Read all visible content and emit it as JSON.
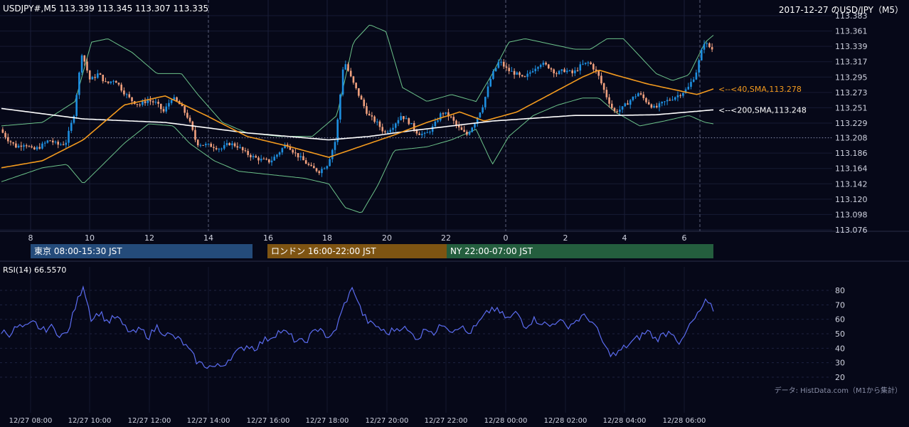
{
  "header": {
    "ohlc": "USDJPY#,M5 113.339 113.345 113.307 113.335",
    "title_right": "2017-12-27 のUSD/JPY（M5）"
  },
  "sessions": {
    "tokyo": "東京 08:00-15:30 JST",
    "london": "ロンドン 16:00-22:00 JST",
    "ny": "NY 22:00-07:00 JST"
  },
  "rsi": {
    "label": "RSI(14) 66.5570"
  },
  "credit": "データ: HistData.com（M1から集計）",
  "colors": {
    "bull": "#1e8fe0",
    "bear": "#f0a07e",
    "sma40": "#f39a1e",
    "sma200": "#ffffff",
    "bands": "#6cc28a",
    "rsi": "#5b6cf0"
  },
  "chart_data": [
    {
      "type": "candlestick",
      "ylim": [
        113.076,
        113.383
      ],
      "y_ticks": [
        "113.383",
        "113.361",
        "113.339",
        "113.317",
        "113.295",
        "113.273",
        "113.251",
        "113.229",
        "113.208",
        "113.186",
        "113.164",
        "113.142",
        "113.120",
        "113.098",
        "113.076"
      ],
      "x_ticks": [
        "8",
        "10",
        "12",
        "14",
        "16",
        "18",
        "20",
        "22",
        "0",
        "2",
        "4",
        "6"
      ],
      "annotations": [
        {
          "text": "<--<40,SMA,113.278",
          "value": 113.278
        },
        {
          "text": "<--<200,SMA,113.248",
          "value": 113.248
        }
      ],
      "reference_line": 113.208,
      "price_path": [
        [
          0,
          113.22
        ],
        [
          1,
          113.205
        ],
        [
          2,
          113.195
        ],
        [
          3,
          113.2
        ],
        [
          4,
          113.19
        ],
        [
          5,
          113.196
        ],
        [
          6,
          113.205
        ],
        [
          7,
          113.198
        ],
        [
          8,
          113.2
        ],
        [
          9,
          113.24
        ],
        [
          10,
          113.33
        ],
        [
          11,
          113.29
        ],
        [
          12,
          113.3
        ],
        [
          13,
          113.285
        ],
        [
          14,
          113.292
        ],
        [
          15,
          113.275
        ],
        [
          16,
          113.262
        ],
        [
          17,
          113.255
        ],
        [
          18,
          113.262
        ],
        [
          19,
          113.258
        ],
        [
          20,
          113.245
        ],
        [
          21,
          113.266
        ],
        [
          22,
          113.255
        ],
        [
          23,
          113.236
        ],
        [
          24,
          113.2
        ],
        [
          25,
          113.198
        ],
        [
          26,
          113.196
        ],
        [
          27,
          113.192
        ],
        [
          28,
          113.2
        ],
        [
          29,
          113.196
        ],
        [
          30,
          113.186
        ],
        [
          31,
          113.18
        ],
        [
          32,
          113.176
        ],
        [
          33,
          113.174
        ],
        [
          34,
          113.186
        ],
        [
          35,
          113.2
        ],
        [
          36,
          113.186
        ],
        [
          37,
          113.176
        ],
        [
          38,
          113.165
        ],
        [
          39,
          113.16
        ],
        [
          40,
          113.17
        ],
        [
          41,
          113.205
        ],
        [
          42,
          113.32
        ],
        [
          43,
          113.29
        ],
        [
          44,
          113.265
        ],
        [
          45,
          113.24
        ],
        [
          46,
          113.23
        ],
        [
          47,
          113.215
        ],
        [
          48,
          113.225
        ],
        [
          49,
          113.24
        ],
        [
          50,
          113.23
        ],
        [
          51,
          113.215
        ],
        [
          52,
          113.212
        ],
        [
          53,
          113.225
        ],
        [
          54,
          113.245
        ],
        [
          55,
          113.238
        ],
        [
          56,
          113.222
        ],
        [
          57,
          113.212
        ],
        [
          58,
          113.23
        ],
        [
          59,
          113.255
        ],
        [
          60,
          113.295
        ],
        [
          61,
          113.318
        ],
        [
          62,
          113.305
        ],
        [
          63,
          113.3
        ],
        [
          64,
          113.292
        ],
        [
          65,
          113.305
        ],
        [
          66,
          113.315
        ],
        [
          67,
          113.31
        ],
        [
          68,
          113.3
        ],
        [
          69,
          113.305
        ],
        [
          70,
          113.3
        ],
        [
          71,
          113.312
        ],
        [
          72,
          113.316
        ],
        [
          73,
          113.3
        ],
        [
          74,
          113.27
        ],
        [
          75,
          113.245
        ],
        [
          76,
          113.25
        ],
        [
          77,
          113.262
        ],
        [
          78,
          113.272
        ],
        [
          79,
          113.26
        ],
        [
          80,
          113.25
        ],
        [
          81,
          113.258
        ],
        [
          82,
          113.264
        ],
        [
          83,
          113.27
        ],
        [
          84,
          113.278
        ],
        [
          85,
          113.3
        ],
        [
          86,
          113.345
        ],
        [
          87,
          113.335
        ]
      ],
      "sma40_path": [
        [
          0,
          113.165
        ],
        [
          5,
          113.175
        ],
        [
          10,
          113.205
        ],
        [
          15,
          113.255
        ],
        [
          20,
          113.268
        ],
        [
          25,
          113.24
        ],
        [
          30,
          113.21
        ],
        [
          35,
          113.196
        ],
        [
          40,
          113.18
        ],
        [
          43,
          113.192
        ],
        [
          48,
          113.212
        ],
        [
          52,
          113.23
        ],
        [
          56,
          113.245
        ],
        [
          59,
          113.232
        ],
        [
          63,
          113.245
        ],
        [
          67,
          113.27
        ],
        [
          71,
          113.295
        ],
        [
          73,
          113.305
        ],
        [
          75,
          113.298
        ],
        [
          79,
          113.285
        ],
        [
          83,
          113.275
        ],
        [
          85,
          113.27
        ],
        [
          87,
          113.278
        ]
      ],
      "sma200_path": [
        [
          0,
          113.25
        ],
        [
          10,
          113.235
        ],
        [
          20,
          113.23
        ],
        [
          30,
          113.215
        ],
        [
          40,
          113.205
        ],
        [
          45,
          113.21
        ],
        [
          50,
          113.218
        ],
        [
          55,
          113.225
        ],
        [
          60,
          113.232
        ],
        [
          65,
          113.236
        ],
        [
          70,
          113.24
        ],
        [
          75,
          113.24
        ],
        [
          80,
          113.241
        ],
        [
          87,
          113.248
        ]
      ],
      "upper_band_path": [
        [
          0,
          113.225
        ],
        [
          5,
          113.23
        ],
        [
          9,
          113.26
        ],
        [
          11,
          113.345
        ],
        [
          13,
          113.35
        ],
        [
          16,
          113.33
        ],
        [
          19,
          113.3
        ],
        [
          22,
          113.3
        ],
        [
          24,
          113.27
        ],
        [
          27,
          113.23
        ],
        [
          30,
          113.215
        ],
        [
          34,
          113.21
        ],
        [
          38,
          113.21
        ],
        [
          41,
          113.24
        ],
        [
          43,
          113.345
        ],
        [
          45,
          113.37
        ],
        [
          47,
          113.36
        ],
        [
          49,
          113.28
        ],
        [
          52,
          113.26
        ],
        [
          55,
          113.27
        ],
        [
          58,
          113.26
        ],
        [
          60,
          113.3
        ],
        [
          62,
          113.345
        ],
        [
          64,
          113.35
        ],
        [
          66,
          113.345
        ],
        [
          68,
          113.34
        ],
        [
          70,
          113.335
        ],
        [
          72,
          113.335
        ],
        [
          74,
          113.35
        ],
        [
          76,
          113.35
        ],
        [
          78,
          113.325
        ],
        [
          80,
          113.3
        ],
        [
          82,
          113.29
        ],
        [
          84,
          113.298
        ],
        [
          86,
          113.345
        ],
        [
          87,
          113.355
        ]
      ],
      "lower_band_path": [
        [
          0,
          113.145
        ],
        [
          5,
          113.165
        ],
        [
          8,
          113.17
        ],
        [
          10,
          113.142
        ],
        [
          12,
          113.165
        ],
        [
          15,
          113.2
        ],
        [
          18,
          113.228
        ],
        [
          21,
          113.225
        ],
        [
          23,
          113.2
        ],
        [
          26,
          113.175
        ],
        [
          29,
          113.16
        ],
        [
          33,
          113.155
        ],
        [
          37,
          113.15
        ],
        [
          40,
          113.142
        ],
        [
          42,
          113.108
        ],
        [
          44,
          113.1
        ],
        [
          46,
          113.14
        ],
        [
          48,
          113.19
        ],
        [
          52,
          113.195
        ],
        [
          55,
          113.205
        ],
        [
          58,
          113.22
        ],
        [
          60,
          113.17
        ],
        [
          62,
          113.21
        ],
        [
          65,
          113.24
        ],
        [
          68,
          113.255
        ],
        [
          71,
          113.265
        ],
        [
          73,
          113.265
        ],
        [
          75,
          113.245
        ],
        [
          78,
          113.225
        ],
        [
          81,
          113.232
        ],
        [
          84,
          113.24
        ],
        [
          86,
          113.23
        ],
        [
          87,
          113.228
        ]
      ]
    },
    {
      "type": "line",
      "name": "RSI(14)",
      "ylim": [
        20,
        80
      ],
      "y_ticks": [
        "80",
        "70",
        "60",
        "50",
        "40",
        "30",
        "20"
      ],
      "x_ticks": [
        "12/27 08:00",
        "12/27 10:00",
        "12/27 12:00",
        "12/27 14:00",
        "12/27 16:00",
        "12/27 18:00",
        "12/27 20:00",
        "12/27 22:00",
        "12/28 00:00",
        "12/28 02:00",
        "12/28 04:00",
        "12/28 06:00"
      ],
      "values": [
        [
          0,
          52
        ],
        [
          1,
          50
        ],
        [
          2,
          55
        ],
        [
          3,
          54
        ],
        [
          4,
          58
        ],
        [
          5,
          52
        ],
        [
          6,
          55
        ],
        [
          7,
          50
        ],
        [
          8,
          49
        ],
        [
          9,
          68
        ],
        [
          10,
          84
        ],
        [
          11,
          60
        ],
        [
          12,
          65
        ],
        [
          13,
          58
        ],
        [
          14,
          62
        ],
        [
          15,
          55
        ],
        [
          16,
          50
        ],
        [
          17,
          53
        ],
        [
          18,
          48
        ],
        [
          19,
          55
        ],
        [
          20,
          50
        ],
        [
          21,
          48
        ],
        [
          22,
          45
        ],
        [
          23,
          38
        ],
        [
          24,
          30
        ],
        [
          25,
          28
        ],
        [
          26,
          27
        ],
        [
          27,
          28
        ],
        [
          28,
          34
        ],
        [
          29,
          38
        ],
        [
          30,
          42
        ],
        [
          31,
          40
        ],
        [
          32,
          45
        ],
        [
          33,
          48
        ],
        [
          34,
          52
        ],
        [
          35,
          50
        ],
        [
          36,
          45
        ],
        [
          37,
          44
        ],
        [
          38,
          50
        ],
        [
          39,
          55
        ],
        [
          40,
          45
        ],
        [
          41,
          55
        ],
        [
          42,
          72
        ],
        [
          43,
          82
        ],
        [
          44,
          65
        ],
        [
          45,
          57
        ],
        [
          46,
          55
        ],
        [
          47,
          50
        ],
        [
          48,
          53
        ],
        [
          49,
          55
        ],
        [
          50,
          50
        ],
        [
          51,
          47
        ],
        [
          52,
          55
        ],
        [
          53,
          50
        ],
        [
          54,
          58
        ],
        [
          55,
          52
        ],
        [
          56,
          56
        ],
        [
          57,
          50
        ],
        [
          58,
          55
        ],
        [
          59,
          62
        ],
        [
          60,
          68
        ],
        [
          61,
          64
        ],
        [
          62,
          60
        ],
        [
          63,
          65
        ],
        [
          64,
          55
        ],
        [
          65,
          60
        ],
        [
          66,
          58
        ],
        [
          67,
          55
        ],
        [
          68,
          60
        ],
        [
          69,
          55
        ],
        [
          70,
          58
        ],
        [
          71,
          62
        ],
        [
          72,
          60
        ],
        [
          73,
          50
        ],
        [
          74,
          38
        ],
        [
          75,
          35
        ],
        [
          76,
          40
        ],
        [
          77,
          44
        ],
        [
          78,
          48
        ],
        [
          79,
          52
        ],
        [
          80,
          46
        ],
        [
          81,
          50
        ],
        [
          82,
          52
        ],
        [
          83,
          42
        ],
        [
          84,
          55
        ],
        [
          85,
          62
        ],
        [
          86,
          72
        ],
        [
          87,
          67
        ]
      ]
    }
  ]
}
